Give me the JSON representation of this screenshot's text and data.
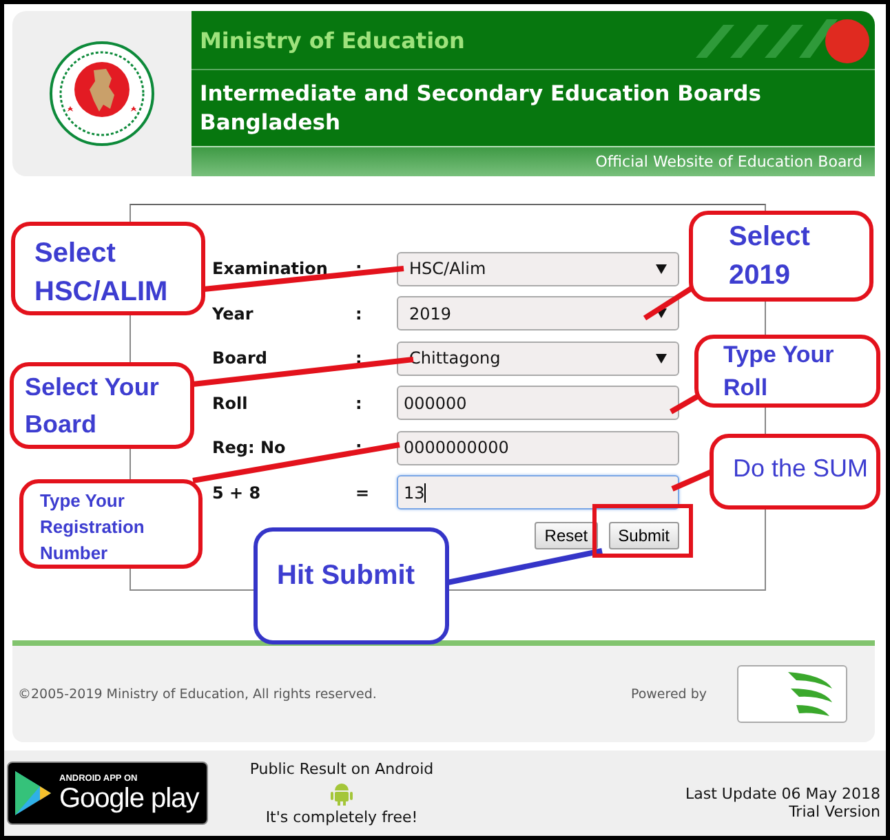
{
  "header": {
    "ministry": "Ministry of Education",
    "title": "Intermediate and Secondary Education Boards Bangladesh",
    "tagline": "Official Website of Education Board"
  },
  "form": {
    "fields": [
      {
        "label": "Examination",
        "separator": ":",
        "kind": "select",
        "value": "HSC/Alim",
        "focused": false
      },
      {
        "label": "Year",
        "separator": ":",
        "kind": "select",
        "value": "2019",
        "focused": false
      },
      {
        "label": "Board",
        "separator": ":",
        "kind": "select",
        "value": "Chittagong",
        "focused": false
      },
      {
        "label": "Roll",
        "separator": ":",
        "kind": "input",
        "value": "000000",
        "focused": false
      },
      {
        "label": "Reg: No",
        "separator": ":",
        "kind": "input",
        "value": "0000000000",
        "focused": false
      },
      {
        "label": "5 + 8",
        "separator": "=",
        "kind": "input",
        "value": "13",
        "focused": true
      }
    ],
    "buttons": [
      "Reset",
      "Submit"
    ]
  },
  "footer": {
    "copyright": "©2005-2019 Ministry of Education, All rights reserved.",
    "powered_by": "Powered by"
  },
  "bottom_bar": {
    "badge_top": "ANDROID APP ON",
    "badge_main": "Google play",
    "app_title": "Public Result on Android",
    "app_note": "It's completely free!",
    "last_update": "Last Update 06 May 2018",
    "version": "Trial Version"
  },
  "annotations": [
    {
      "text": "Select HSC/ALIM",
      "color": "#e3121c"
    },
    {
      "text": "Select 2019",
      "color": "#e3121c"
    },
    {
      "text": "Select Your Board",
      "color": "#e3121c"
    },
    {
      "text": "Type Your Roll",
      "color": "#e3121c"
    },
    {
      "text": "Type Your Registration Number",
      "color": "#e3121c"
    },
    {
      "text": "Do the SUM",
      "color": "#e3121c"
    },
    {
      "text": "Hit Submit",
      "color": "#3535c8"
    }
  ]
}
